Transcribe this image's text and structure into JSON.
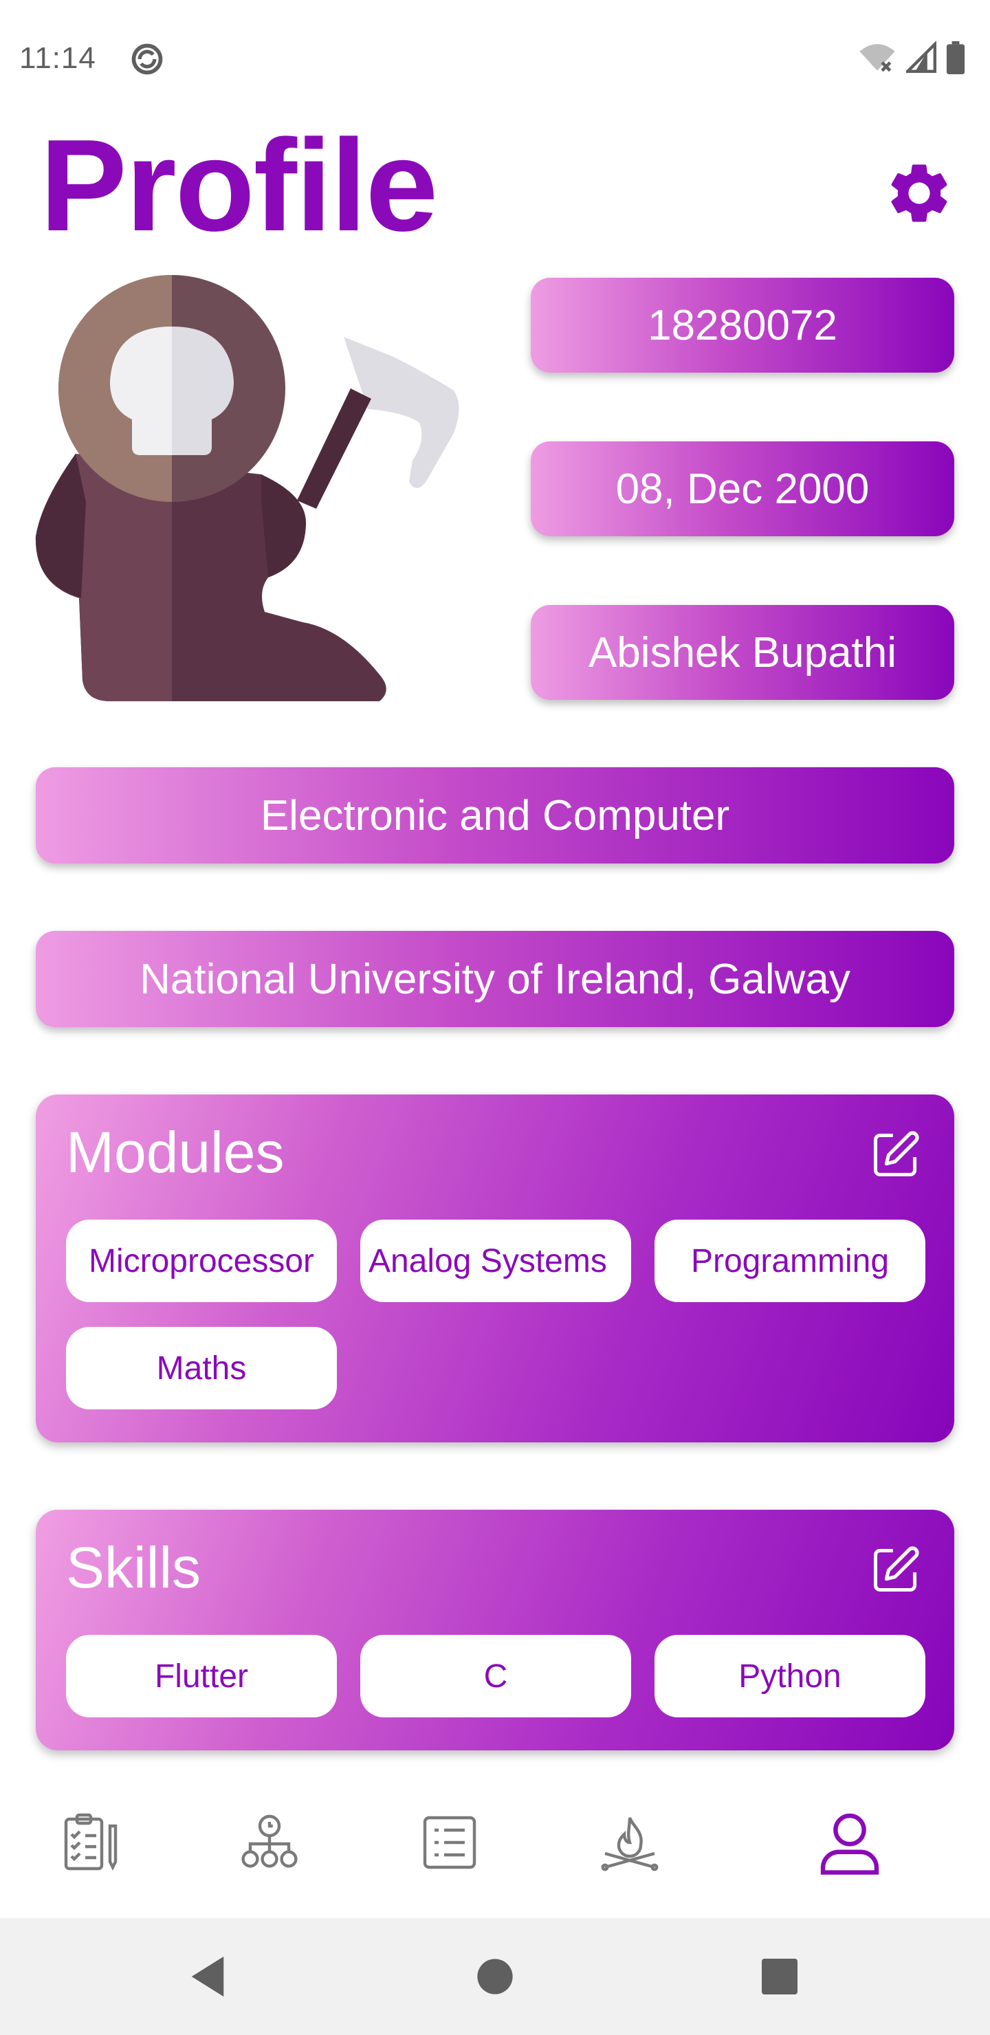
{
  "status_bar": {
    "time": "11:14"
  },
  "header": {
    "title": "Profile"
  },
  "profile": {
    "student_id": "18280072",
    "dob": "08, Dec 2000",
    "name": "Abishek Bupathi",
    "course": "Electronic and Computer",
    "university": "National University of Ireland, Galway"
  },
  "modules": {
    "title": "Modules",
    "items": [
      "Microprocessor",
      "Analog Systems",
      "Programming",
      "Maths"
    ]
  },
  "skills": {
    "title": "Skills",
    "items": [
      "Flutter",
      "C",
      "Python"
    ]
  },
  "nav": {
    "items": [
      "tasks-icon",
      "hierarchy-icon",
      "list-icon",
      "campfire-icon",
      "profile-icon"
    ],
    "active": "profile-icon"
  },
  "colors": {
    "accent": "#8a0ab9",
    "gradient_start": "#ee9ce3",
    "gradient_end": "#8a06bb",
    "inactive_icon": "#7a7a7a"
  }
}
